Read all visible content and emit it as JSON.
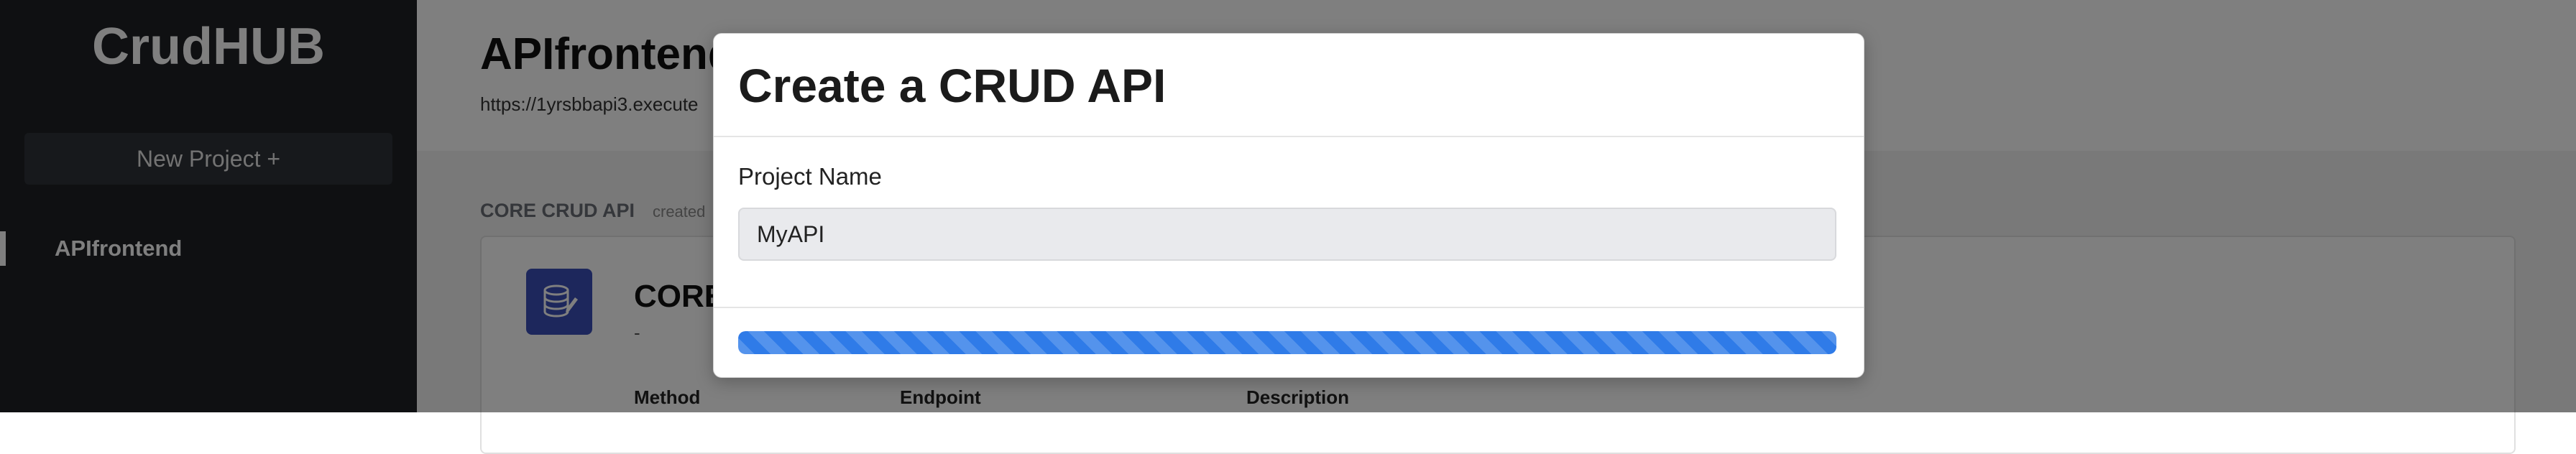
{
  "sidebar": {
    "brand": "CrudHUB",
    "new_project_label": "New Project +",
    "items": [
      {
        "label": "APIfrontend",
        "active": true
      }
    ]
  },
  "header": {
    "project_title": "APIfrontend",
    "project_url": "https://1yrsbbapi3.execute"
  },
  "content": {
    "section_label": "CORE CRUD API",
    "section_sub": "created",
    "card": {
      "name": "CORE",
      "description": "-",
      "columns": [
        "Method",
        "Endpoint",
        "Description"
      ]
    }
  },
  "modal": {
    "title": "Create a CRUD API",
    "field_label": "Project Name",
    "field_value": "MyAPI",
    "progress_percent": 100
  },
  "colors": {
    "sidebar_bg": "#1e2125",
    "progress": "#2f7be8",
    "api_icon_bg": "#3a4fb8"
  },
  "icons": {
    "api_icon": "database-edit-icon"
  }
}
